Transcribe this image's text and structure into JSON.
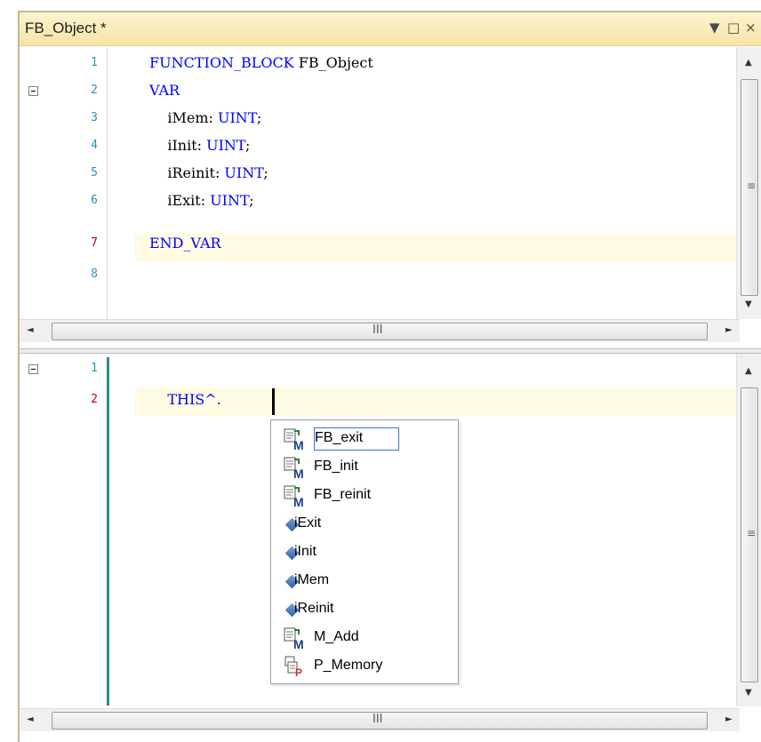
{
  "window": {
    "title": "FB_Object *",
    "menu_icon": "▼",
    "maximize_icon": "□",
    "close_icon": "×"
  },
  "declaration": {
    "line_numbers": [
      "1",
      "2",
      "3",
      "4",
      "5",
      "6",
      "7",
      "8"
    ],
    "lines": [
      {
        "prefix": "",
        "keyword": "FUNCTION_BLOCK",
        "rest": " FB_Object"
      },
      {
        "prefix": "",
        "keyword": "VAR",
        "rest": ""
      },
      {
        "prefix": "    iMem: ",
        "keyword": "UINT",
        "rest": ";"
      },
      {
        "prefix": "    iInit: ",
        "keyword": "UINT",
        "rest": ";"
      },
      {
        "prefix": "    iReinit: ",
        "keyword": "UINT",
        "rest": ";"
      },
      {
        "prefix": "    iExit: ",
        "keyword": "UINT",
        "rest": ";"
      },
      {
        "prefix": "",
        "keyword": "END_VAR",
        "rest": ""
      },
      {
        "prefix": "",
        "keyword": "",
        "rest": ""
      }
    ]
  },
  "implementation": {
    "line_numbers": [
      "1",
      "2"
    ],
    "code_line_2": "    THIS^."
  },
  "scrollbars": {
    "grip": "≡",
    "hgrip": "III",
    "up": "▲",
    "down": "▼",
    "left": "◄",
    "right": "►"
  },
  "autocomplete": {
    "items": [
      {
        "label": "FB_exit",
        "icon": "method-icon",
        "selected": true
      },
      {
        "label": "FB_init",
        "icon": "method-icon"
      },
      {
        "label": "FB_reinit",
        "icon": "method-icon"
      },
      {
        "label": "iExit",
        "icon": "variable-icon"
      },
      {
        "label": "iInit",
        "icon": "variable-icon"
      },
      {
        "label": "iMem",
        "icon": "variable-icon"
      },
      {
        "label": "iReinit",
        "icon": "variable-icon"
      },
      {
        "label": "M_Add",
        "icon": "method-icon"
      },
      {
        "label": "P_Memory",
        "icon": "property-icon"
      }
    ]
  },
  "colors": {
    "keyword": "#0000ff",
    "line_number": "#2b91af",
    "current_line_number": "#c00000",
    "current_line_bg": "#fffbe3",
    "title_bar": "#f6e3a6"
  }
}
